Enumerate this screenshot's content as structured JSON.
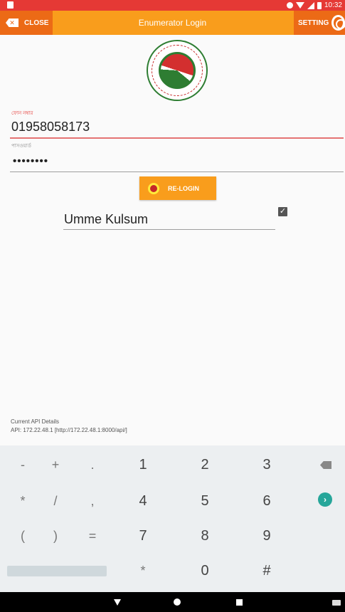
{
  "status_bar": {
    "time": "10:32"
  },
  "toolbar": {
    "close_label": "CLOSE",
    "title": "Enumerator Login",
    "setting_label": "SETTING"
  },
  "form": {
    "phone_label": "ফোন নম্বার",
    "phone_value": "01958058173",
    "password_label": "পাসওয়ার্ড",
    "password_value": "••••••••",
    "relogin_label": "RE-LOGIN",
    "username": "Umme Kulsum",
    "checkbox_checked": true
  },
  "api": {
    "title": "Current API Details",
    "value": "API: 172.22.48.1 [http://172.22.48.1:8000/api/]"
  },
  "keyboard": {
    "rows": [
      [
        "-",
        "+",
        ".",
        "1",
        "2",
        "3"
      ],
      [
        "*",
        "/",
        ",",
        "4",
        "5",
        "6"
      ],
      [
        "(",
        ")",
        "=",
        "7",
        "8",
        "9"
      ],
      [
        "",
        "",
        "",
        "*",
        "0",
        "#"
      ]
    ]
  },
  "colors": {
    "status_bar": "#e53935",
    "toolbar": "#f99d1c",
    "toolbar_buttons": "#ec6a16",
    "accent_green": "#26a69a"
  }
}
